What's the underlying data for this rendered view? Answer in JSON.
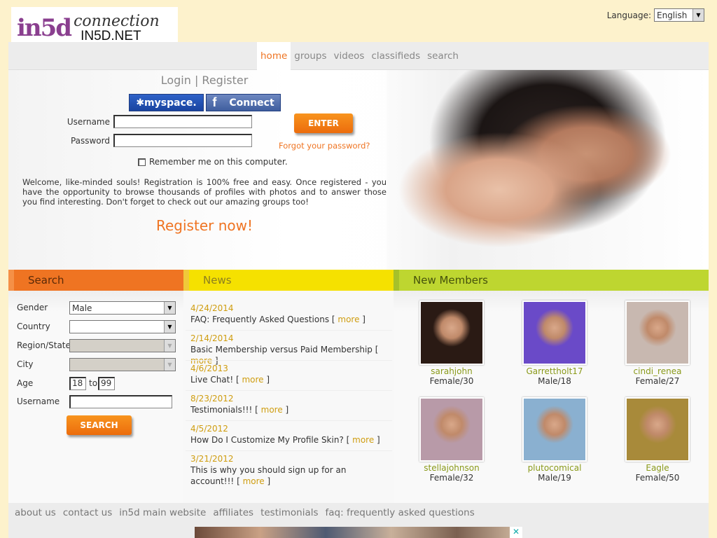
{
  "logo": {
    "text1": "in5d",
    "text2": "connection",
    "text3": "IN5D.NET"
  },
  "language": {
    "label": "Language:",
    "value": "English"
  },
  "nav": [
    {
      "label": "home",
      "active": true
    },
    {
      "label": "groups"
    },
    {
      "label": "videos"
    },
    {
      "label": "classifieds"
    },
    {
      "label": "search"
    }
  ],
  "login": {
    "title": "Login | Register",
    "myspace": "myspace.",
    "facebook": "Connect",
    "username_label": "Username",
    "password_label": "Password",
    "enter": "ENTER",
    "forgot": "Forgot your password?",
    "remember": "Remember me on this computer.",
    "welcome": "Welcome, like-minded souls! Registration is 100% free and easy. Once registered - you have the opportunity to browse thousands of profiles with photos and to answer those you find interesting. Don't forget to check out our amazing groups too!",
    "register_now": "Register now!"
  },
  "sections": {
    "search": "Search",
    "news": "News",
    "members": "New Members"
  },
  "search": {
    "gender_label": "Gender",
    "gender": "Male",
    "country_label": "Country",
    "region_label": "Region/State",
    "city_label": "City",
    "age_label": "Age",
    "age_from": "18",
    "age_to_label": "to",
    "age_to": "99",
    "username_label": "Username",
    "button": "SEARCH"
  },
  "news": [
    {
      "date": "4/24/2014",
      "title": "FAQ: Frequently Asked Questions",
      "more": "more"
    },
    {
      "date": "2/14/2014",
      "title": "Basic Membership versus Paid Membership",
      "more": "more"
    },
    {
      "date": "4/6/2013",
      "title": "Live Chat!",
      "more": "more"
    },
    {
      "date": "8/23/2012",
      "title": "Testimonials!!!",
      "more": "more"
    },
    {
      "date": "4/5/2012",
      "title": "How Do I Customize My Profile Skin?",
      "more": "more"
    },
    {
      "date": "3/21/2012",
      "title": "This is why you should sign up for an account!!!",
      "more": "more"
    }
  ],
  "members": [
    {
      "name": "sarahjohn",
      "info": "Female/30",
      "color": "#2a1a14"
    },
    {
      "name": "Garrettholt17",
      "info": "Male/18",
      "color": "#6a4ac8"
    },
    {
      "name": "cindi_renea",
      "info": "Female/27",
      "color": "#c8b8b0"
    },
    {
      "name": "stellajohnson",
      "info": "Female/32",
      "color": "#b89aa8"
    },
    {
      "name": "plutocomical",
      "info": "Male/19",
      "color": "#8ab0d0"
    },
    {
      "name": "Eagle",
      "info": "Female/50",
      "color": "#a88a3a"
    }
  ],
  "footer": [
    "about us",
    "contact us",
    "in5d main website",
    "affiliates",
    "testimonials",
    "faq: frequently asked questions"
  ],
  "ad": {
    "close": "✕"
  }
}
